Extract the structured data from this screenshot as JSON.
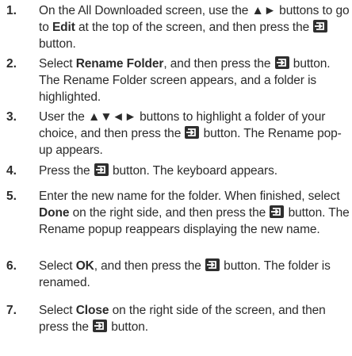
{
  "steps": [
    {
      "number": "1.",
      "parts": [
        {
          "t": "On the All Downloaded screen, use the ▲► buttons to go to "
        },
        {
          "b": "Edit"
        },
        {
          "t": " at the top of the screen, and then press the "
        },
        {
          "icon": "enter-icon"
        },
        {
          "t": " button."
        }
      ]
    },
    {
      "number": "2.",
      "parts": [
        {
          "t": "Select "
        },
        {
          "b": "Rename Folder"
        },
        {
          "t": ", and then press the "
        },
        {
          "icon": "enter-icon"
        },
        {
          "t": " button. The Rename Folder screen appears, and a folder is highlighted."
        }
      ]
    },
    {
      "number": "3.",
      "parts": [
        {
          "t": "User the ▲▼◄► buttons to highlight a folder of your choice, and then press the "
        },
        {
          "icon": "enter-icon"
        },
        {
          "t": " button. The Rename pop-up appears."
        }
      ]
    },
    {
      "number": "4.",
      "parts": [
        {
          "t": "Press the "
        },
        {
          "icon": "enter-icon"
        },
        {
          "t": " button. The keyboard appears."
        }
      ]
    },
    {
      "number": "5.",
      "parts": [
        {
          "t": "Enter the new name for the folder. When finished, select "
        },
        {
          "b": "Done"
        },
        {
          "t": " on the right side, and then press the "
        },
        {
          "icon": "enter-icon"
        },
        {
          "t": " button. The Rename popup reappears displaying the new name."
        }
      ]
    },
    {
      "number": "6.",
      "parts": [
        {
          "t": "Select "
        },
        {
          "b": "OK"
        },
        {
          "t": ", and then press the "
        },
        {
          "icon": "enter-icon"
        },
        {
          "t": " button. The folder is renamed."
        }
      ]
    },
    {
      "number": "7.",
      "parts": [
        {
          "t": "Select "
        },
        {
          "b": "Close"
        },
        {
          "t": " on the right side of the screen, and then press the "
        },
        {
          "icon": "enter-icon"
        },
        {
          "t": " button."
        }
      ]
    }
  ]
}
